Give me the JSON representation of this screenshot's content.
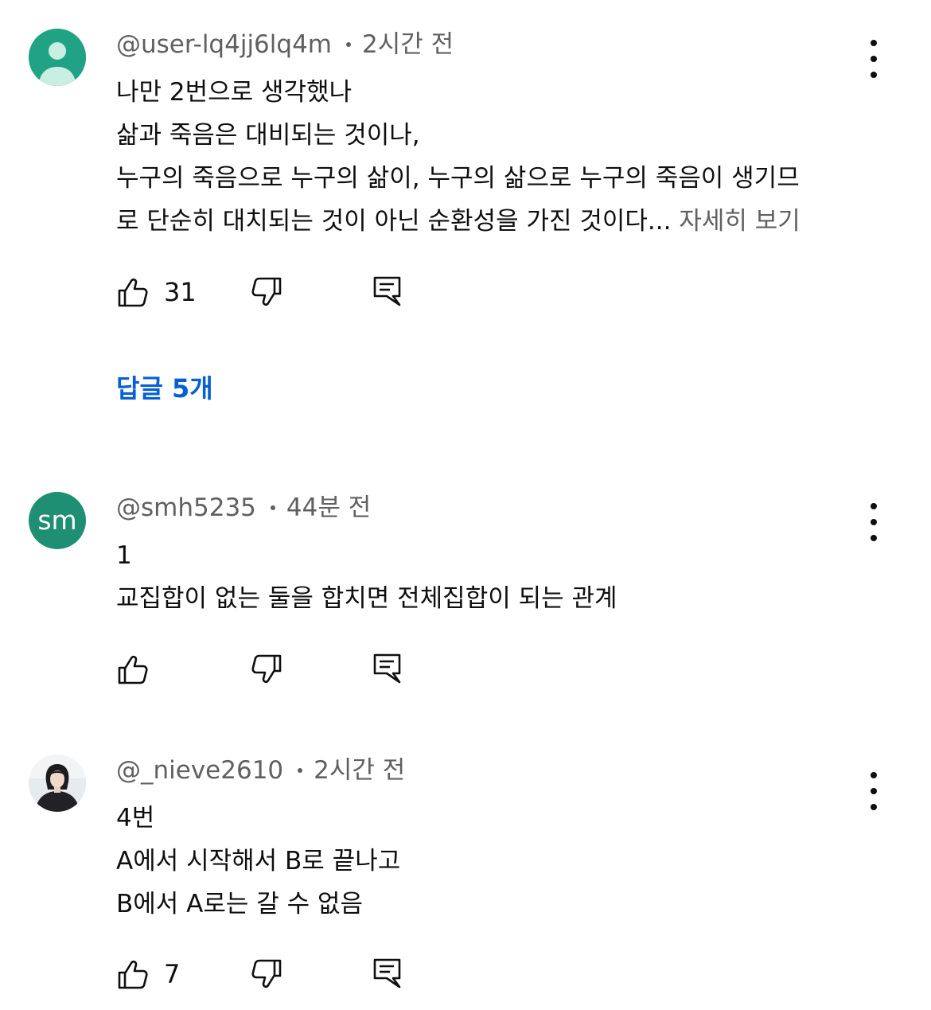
{
  "comments": [
    {
      "author": "@user-lq4jj6lq4m",
      "time": "2시간 전",
      "avatar_type": "default-person-icon",
      "lines": [
        "나만 2번으로 생각했나",
        "삶과 죽음은 대비되는 것이나,",
        "누구의 죽음으로 누구의 삶이, 누구의 삶으로 누구의 죽음이 생기므",
        "로 단순히 대치되는 것이 아닌 순환성을 가진 것이다..."
      ],
      "read_more": " 자세히 보기",
      "likes": "31",
      "replies_label": "답글 5개"
    },
    {
      "author": "@smh5235",
      "time": "44분 전",
      "avatar_type": "initials",
      "avatar_text": "sm",
      "avatar_color": "#1f8f73",
      "lines": [
        "1",
        "교집합이 없는 둘을 합치면 전체집합이 되는 관계"
      ],
      "likes": ""
    },
    {
      "author": "@_nieve2610",
      "time": "2시간 전",
      "avatar_type": "photo-person",
      "lines": [
        "4번",
        "A에서 시작해서 B로 끝나고",
        "B에서 A로는 갈 수 없음"
      ],
      "likes": "7"
    }
  ],
  "icons": {
    "like": "thumb-up-icon",
    "dislike": "thumb-down-icon",
    "reply": "reply-comment-icon",
    "more": "more-vertical-icon"
  },
  "colors": {
    "text": "#0f0f0f",
    "meta": "#606060",
    "link": "#065fd4"
  }
}
